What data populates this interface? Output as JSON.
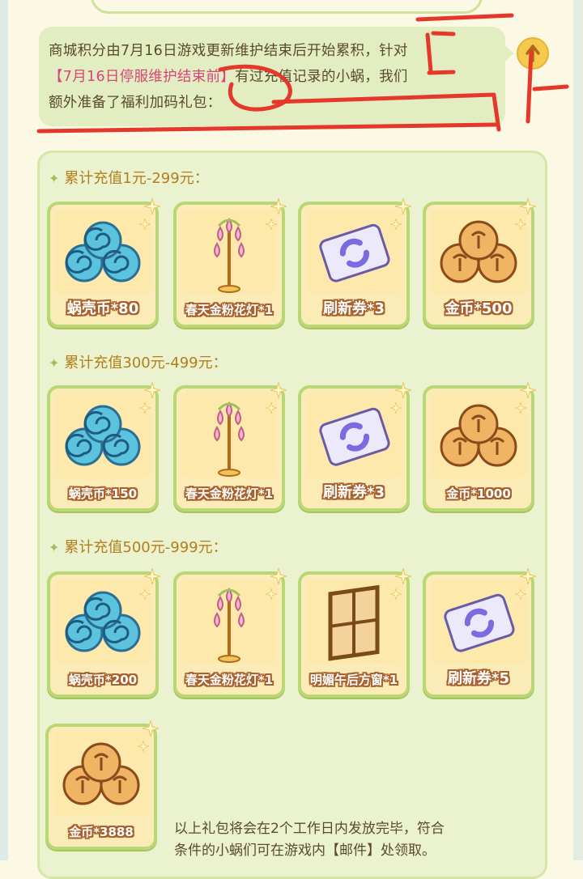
{
  "notice": {
    "line1": "商城积分由7月16日游戏更新维护结束后开始累积，针对",
    "line2_highlight": "【7月16日停服维护结束前】",
    "line2_rest": "有过充值记录的小蜗，我们",
    "line3": "额外准备了福利加码礼包："
  },
  "tiers": [
    {
      "title": "累计充值1元-299元：",
      "items": [
        {
          "label": "蜗壳币*80",
          "icon": "snail-shell-coins-icon"
        },
        {
          "label": "春天金粉花灯*1",
          "icon": "flower-lamp-icon"
        },
        {
          "label": "刷新券*3",
          "icon": "refresh-ticket-icon"
        },
        {
          "label": "金币*500",
          "icon": "gold-coins-icon"
        }
      ]
    },
    {
      "title": "累计充值300元-499元：",
      "items": [
        {
          "label": "蜗壳币*150",
          "icon": "snail-shell-coins-icon"
        },
        {
          "label": "春天金粉花灯*1",
          "icon": "flower-lamp-icon"
        },
        {
          "label": "刷新券*3",
          "icon": "refresh-ticket-icon"
        },
        {
          "label": "金币*1000",
          "icon": "gold-coins-icon"
        }
      ]
    },
    {
      "title": "累计充值500元-999元：",
      "items": [
        {
          "label": "蜗壳币*200",
          "icon": "snail-shell-coins-icon"
        },
        {
          "label": "春天金粉花灯*1",
          "icon": "flower-lamp-icon"
        },
        {
          "label": "明媚午后方窗*1",
          "icon": "window-icon"
        },
        {
          "label": "刷新券*5",
          "icon": "refresh-ticket-icon"
        },
        {
          "label": "金币*3888",
          "icon": "gold-coins-icon"
        }
      ]
    }
  ],
  "footnote": {
    "line1": "以上礼包将会在2个工作日内发放完毕，符合",
    "line2": "条件的小蜗们可在游戏内【邮件】处领取。"
  },
  "colors": {
    "accent_red": "#e5372a",
    "highlight_pink": "#d9447a",
    "card_border": "#b9d774",
    "tier_title": "#b47f1a"
  }
}
